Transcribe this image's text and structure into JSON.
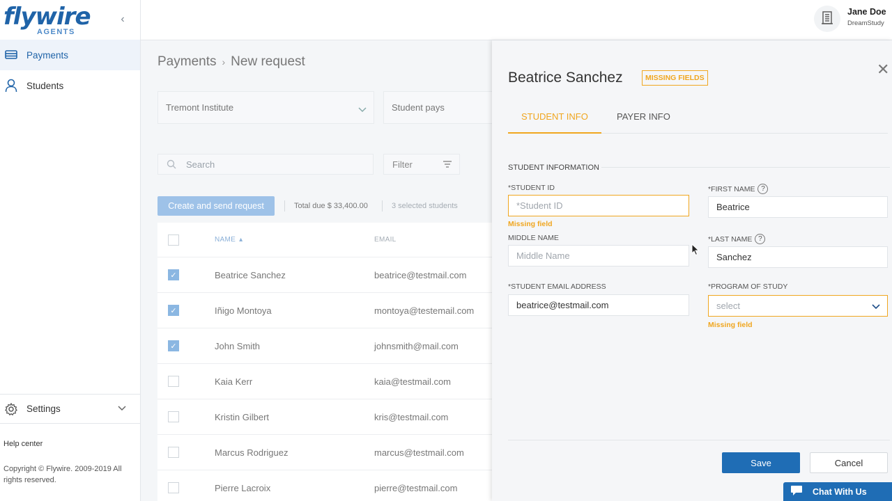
{
  "brand": {
    "logo": "flywire",
    "sub": "AGENTS"
  },
  "sidebar": {
    "items": [
      {
        "label": "Payments",
        "icon": "payments-icon"
      },
      {
        "label": "Students",
        "icon": "user-icon"
      }
    ],
    "settings_label": "Settings",
    "help_label": "Help center",
    "copyright": "Copyright © Flywire. 2009-2019 All rights reserved."
  },
  "header": {
    "user_name": "Jane Doe",
    "user_org": "DreamStudy"
  },
  "main": {
    "breadcrumb": [
      "Payments",
      "New request"
    ],
    "institution_select": "Tremont Institute",
    "payer_select": "Student pays",
    "search_placeholder": "Search",
    "filter_label": "Filter",
    "create_button": "Create and send request",
    "total_due": "Total due $ 33,400.00",
    "selected_count": "3 selected students",
    "table": {
      "headers": {
        "name": "NAME",
        "email": "EMAIL"
      },
      "rows": [
        {
          "name": "Beatrice Sanchez",
          "email": "beatrice@testmail.com",
          "checked": true
        },
        {
          "name": "Iñigo Montoya",
          "email": "montoya@testemail.com",
          "checked": true
        },
        {
          "name": "John Smith",
          "email": "johnsmith@mail.com",
          "checked": true
        },
        {
          "name": "Kaia Kerr",
          "email": "kaia@testmail.com",
          "checked": false
        },
        {
          "name": "Kristin Gilbert",
          "email": "kris@testmail.com",
          "checked": false
        },
        {
          "name": "Marcus Rodriguez",
          "email": "marcus@testmail.com",
          "checked": false
        },
        {
          "name": "Pierre Lacroix",
          "email": "pierre@testmail.com",
          "checked": false
        }
      ]
    }
  },
  "panel": {
    "title": "Beatrice Sanchez",
    "badge": "MISSING FIELDS",
    "tabs": [
      "STUDENT INFO",
      "PAYER INFO"
    ],
    "section": "STUDENT INFORMATION",
    "fields": {
      "student_id": {
        "label": "*STUDENT ID",
        "placeholder": "*Student ID",
        "value": ""
      },
      "first_name": {
        "label": "*FIRST NAME",
        "value": "Beatrice"
      },
      "middle_name": {
        "label": "MIDDLE NAME",
        "placeholder": "Middle Name",
        "value": ""
      },
      "last_name": {
        "label": "*LAST NAME",
        "value": "Sanchez"
      },
      "email": {
        "label": "*STUDENT EMAIL ADDRESS",
        "value": "beatrice@testmail.com"
      },
      "program": {
        "label": "*PROGRAM OF STUDY",
        "placeholder": "select"
      }
    },
    "missing_text": "Missing field",
    "save": "Save",
    "cancel": "Cancel"
  },
  "chat": {
    "label": "Chat With Us"
  },
  "colors": {
    "brand_blue": "#1f63a8",
    "warning": "#f0a61f",
    "primary_button": "#1f6db5"
  }
}
